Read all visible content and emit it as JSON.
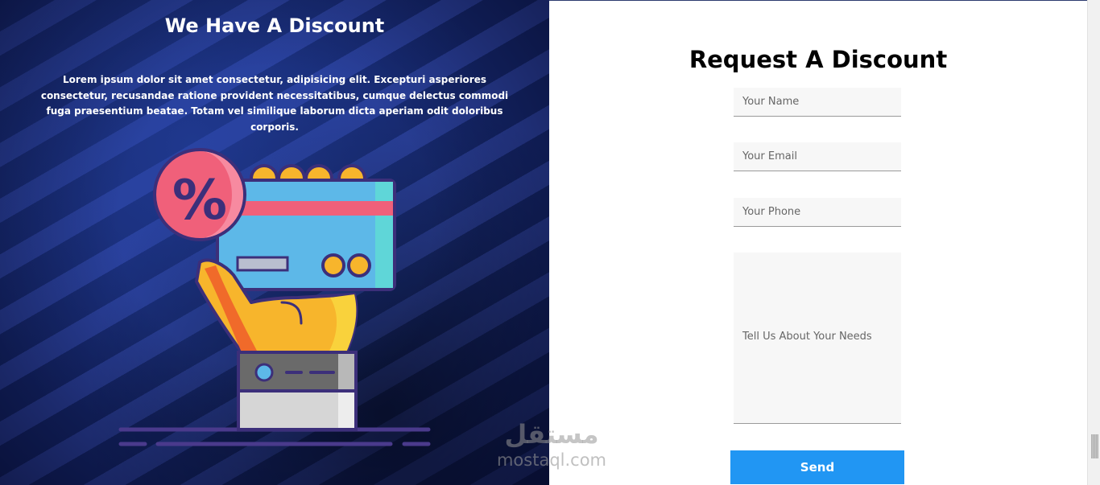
{
  "left_panel": {
    "title": "We Have A Discount",
    "description": "Lorem ipsum dolor sit amet consectetur, adipisicing elit. Excepturi asperiores consectetur, recusandae ratione provident necessitatibus, cumque delectus commodi fuga praesentium beatae. Totam vel similique laborum dicta aperiam odit doloribus corporis.",
    "illustration_symbol": "%",
    "colors": {
      "background": "#1b2f7e",
      "stripe": "#2a3f98"
    }
  },
  "form": {
    "title": "Request A Discount",
    "name_placeholder": "Your Name",
    "email_placeholder": "Your Email",
    "phone_placeholder": "Your Phone",
    "message_placeholder": "Tell Us About Your Needs",
    "send_label": "Send",
    "colors": {
      "button": "#2196f3",
      "field_bg": "#f7f7f7"
    }
  },
  "watermark": {
    "arabic": "مستقل",
    "latin": "mostaql.com"
  }
}
